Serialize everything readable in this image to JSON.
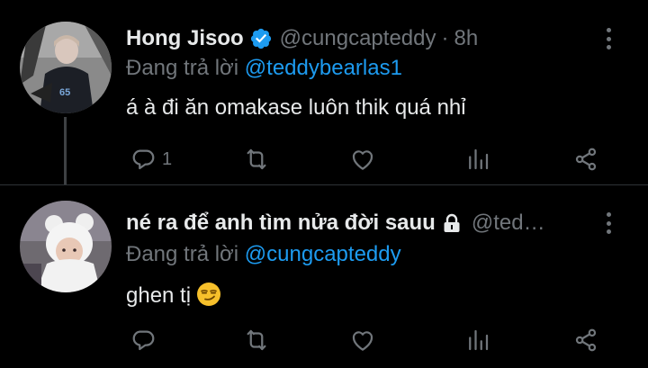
{
  "tweets": [
    {
      "display_name": "Hong Jisoo",
      "verified": true,
      "handle": "@cungcapteddy",
      "separator": "·",
      "time": "8h",
      "reply_prefix": "Đang trả lời",
      "reply_to": "@teddybearlas1",
      "text": "á à đi ăn omakase luôn thik quá nhỉ",
      "reply_count": "1"
    },
    {
      "display_name": "né ra để anh tìm nửa đời sauu",
      "locked": true,
      "handle": "@teddybearlas1",
      "handle_display": "@ted…",
      "reply_prefix": "Đang trả lời",
      "reply_to": "@cungcapteddy",
      "text": "ghen tị",
      "emoji": "smirking-face",
      "reply_count": ""
    }
  ],
  "colors": {
    "background": "#000000",
    "primary_text": "#e7e9ea",
    "secondary_text": "#71767b",
    "link": "#1d9bf0",
    "verified_badge": "#1d9bf0"
  },
  "icons": [
    "verified-badge-icon",
    "lock-icon",
    "more-icon",
    "reply-icon",
    "retweet-icon",
    "like-icon",
    "stats-icon",
    "share-icon"
  ]
}
